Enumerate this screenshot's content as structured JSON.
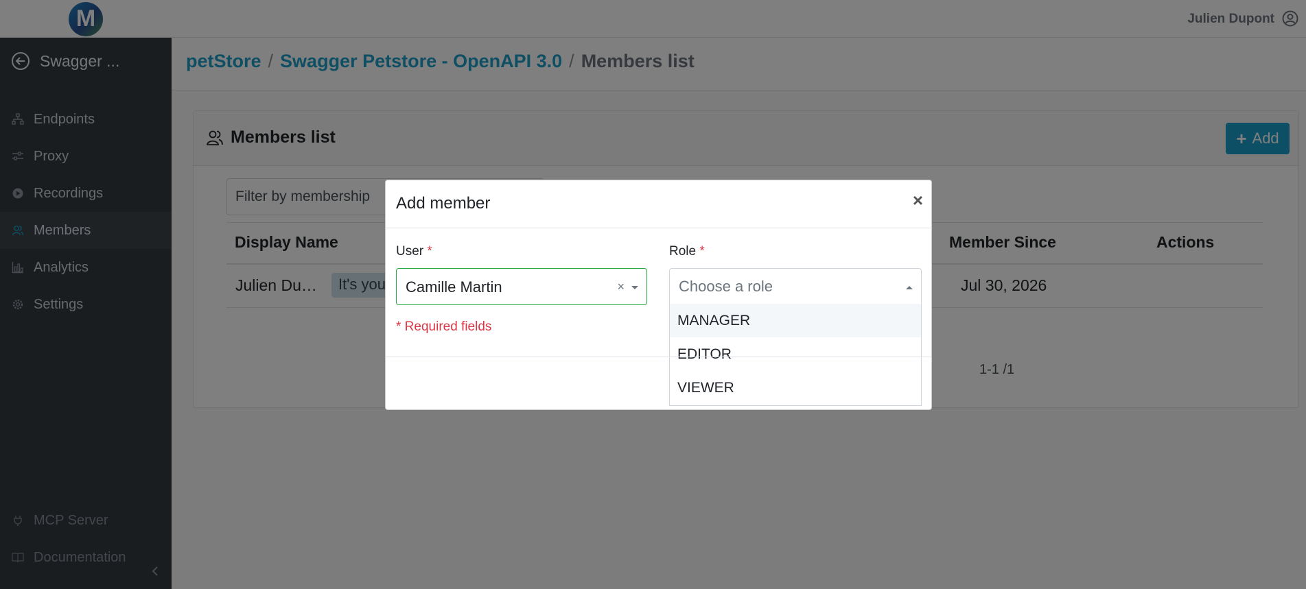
{
  "topbar": {
    "logo_letter": "M",
    "user_name": "Julien Dupont"
  },
  "sidebar": {
    "project_title": "Swagger ...",
    "items": [
      {
        "label": "Endpoints"
      },
      {
        "label": "Proxy"
      },
      {
        "label": "Recordings"
      },
      {
        "label": "Members"
      },
      {
        "label": "Analytics"
      },
      {
        "label": "Settings"
      }
    ],
    "bottom_items": [
      {
        "label": "MCP Server"
      },
      {
        "label": "Documentation"
      }
    ]
  },
  "breadcrumb": {
    "items": [
      "petStore",
      "Swagger Petstore - OpenAPI 3.0"
    ],
    "separator": "/",
    "current": "Members list"
  },
  "card": {
    "title": "Members list",
    "add_label": "Add"
  },
  "filter": {
    "placeholder": "Filter by membership"
  },
  "table": {
    "headers": {
      "display_name": "Display Name",
      "member_since": "Member Since",
      "actions": "Actions"
    },
    "rows": [
      {
        "display_name": "Julien Du…",
        "badge": "It's you",
        "member_since": "Jul 30, 2026"
      }
    ]
  },
  "pager": "1-1 /1",
  "modal": {
    "title": "Add member",
    "close": "×",
    "user_label": "User",
    "role_label": "Role",
    "required_marker": "*",
    "user_value": "Camille Martin",
    "clear": "×",
    "role_placeholder": "Choose a role",
    "role_options": [
      "MANAGER",
      "EDITOR",
      "VIEWER"
    ],
    "required_note": "* Required fields"
  }
}
